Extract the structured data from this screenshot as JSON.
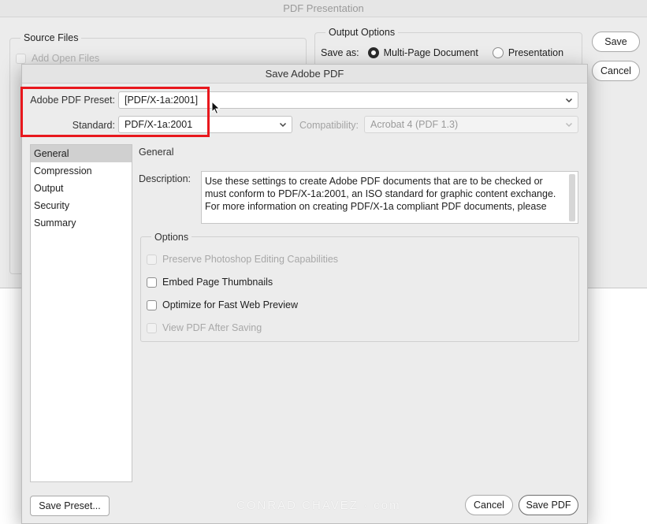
{
  "background_window": {
    "title": "PDF Presentation",
    "source_files": {
      "title": "Source Files",
      "add_open_files": "Add Open Files"
    },
    "output_options": {
      "title": "Output Options",
      "save_as_label": "Save as:",
      "options": [
        "Multi-Page Document",
        "Presentation"
      ],
      "selected": "Multi-Page Document"
    },
    "save_label": "Save",
    "cancel_label": "Cancel"
  },
  "dialog": {
    "title": "Save Adobe PDF",
    "preset_label": "Adobe PDF Preset:",
    "preset_value": "[PDF/X-1a:2001]",
    "standard_label": "Standard:",
    "standard_value": "PDF/X-1a:2001",
    "compatibility_label": "Compatibility:",
    "compatibility_value": "Acrobat 4 (PDF 1.3)",
    "sidebar": {
      "items": [
        "General",
        "Compression",
        "Output",
        "Security",
        "Summary"
      ],
      "selected": "General"
    },
    "section_title": "General",
    "description_label": "Description:",
    "description_text": "Use these settings to create Adobe PDF documents that are to be checked or must conform to PDF/X-1a:2001, an ISO standard for graphic content exchange. For more information on creating PDF/X-1a compliant PDF documents, please",
    "options": {
      "title": "Options",
      "items": [
        {
          "label": "Preserve Photoshop Editing Capabilities",
          "enabled": false,
          "checked": false
        },
        {
          "label": "Embed Page Thumbnails",
          "enabled": true,
          "checked": false
        },
        {
          "label": "Optimize for Fast Web Preview",
          "enabled": true,
          "checked": false
        },
        {
          "label": "View PDF After Saving",
          "enabled": false,
          "checked": false
        }
      ]
    },
    "save_preset_label": "Save Preset...",
    "cancel_label": "Cancel",
    "save_pdf_label": "Save PDF"
  },
  "watermark": "CONRAD CHAVEZ · com",
  "colors": {
    "highlight": "#e8171d",
    "dialog_bg": "#ececec",
    "selected_item_bg": "#d0d0d0"
  },
  "icons": {
    "dropdown": "chevron-down-icon",
    "cursor": "mouse-pointer-icon"
  }
}
